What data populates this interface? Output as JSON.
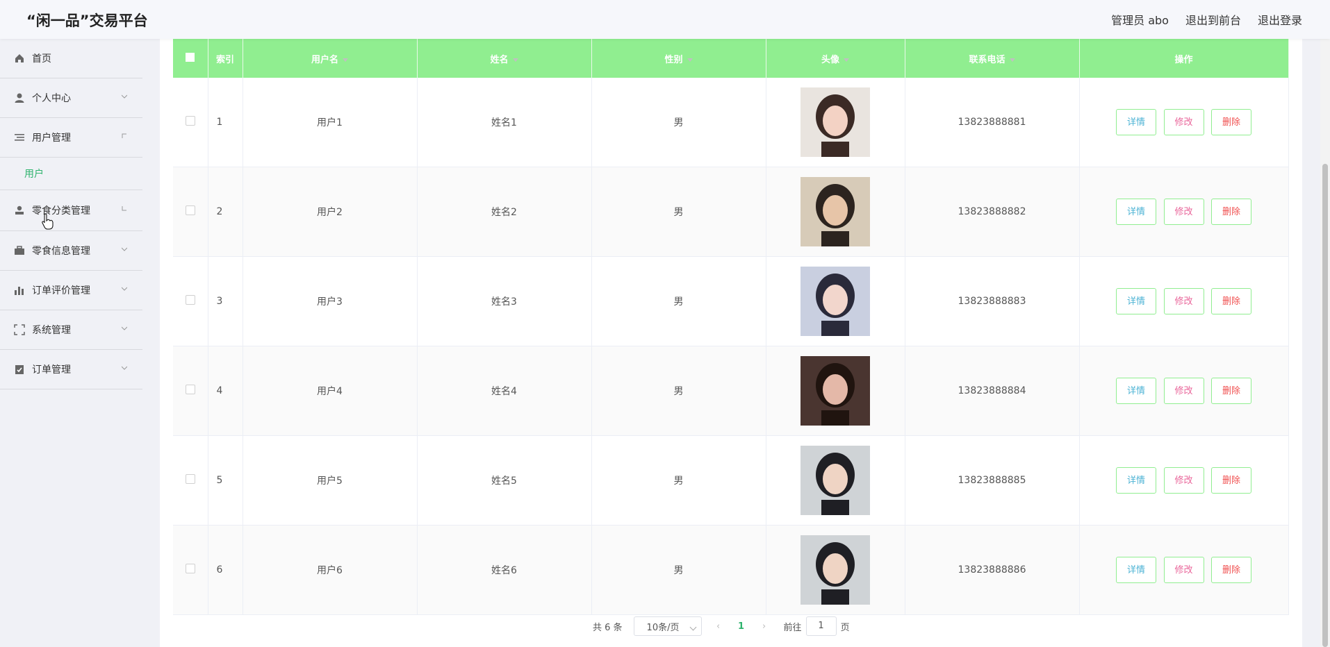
{
  "header": {
    "title": "“闲一品”交易平台",
    "admin": "管理员 abo",
    "to_front": "退出到前台",
    "logout": "退出登录"
  },
  "sidebar": {
    "items": [
      {
        "label": "首页",
        "icon": "home-icon"
      },
      {
        "label": "个人中心",
        "icon": "user-icon"
      },
      {
        "label": "用户管理",
        "icon": "list-icon"
      },
      {
        "label": "零食分类管理",
        "icon": "person-icon"
      },
      {
        "label": "零食信息管理",
        "icon": "briefcase-icon"
      },
      {
        "label": "订单评价管理",
        "icon": "bar-chart-icon"
      },
      {
        "label": "系统管理",
        "icon": "frame-icon"
      },
      {
        "label": "订单管理",
        "icon": "clipboard-icon"
      }
    ],
    "submenu": "用户"
  },
  "table": {
    "headers": {
      "index": "索引",
      "username": "用户名",
      "name": "姓名",
      "gender": "性别",
      "avatar": "头像",
      "phone": "联系电话",
      "actions": "操作"
    },
    "rows": [
      {
        "index": "1",
        "username": "用户1",
        "name": "姓名1",
        "gender": "男",
        "phone": "13823888881"
      },
      {
        "index": "2",
        "username": "用户2",
        "name": "姓名2",
        "gender": "男",
        "phone": "13823888882"
      },
      {
        "index": "3",
        "username": "用户3",
        "name": "姓名3",
        "gender": "男",
        "phone": "13823888883"
      },
      {
        "index": "4",
        "username": "用户4",
        "name": "姓名4",
        "gender": "男",
        "phone": "13823888884"
      },
      {
        "index": "5",
        "username": "用户5",
        "name": "姓名5",
        "gender": "男",
        "phone": "13823888885"
      },
      {
        "index": "6",
        "username": "用户6",
        "name": "姓名6",
        "gender": "男",
        "phone": "13823888886"
      }
    ],
    "buttons": {
      "detail": "详情",
      "edit": "修改",
      "delete": "删除"
    }
  },
  "pagination": {
    "total": "共 6 条",
    "page_size": "10条/页",
    "current_page": "1",
    "goto_label": "前往",
    "goto_value": "1",
    "page_suffix": "页"
  },
  "colors": {
    "header_green": "#90ee90",
    "accent": "#2fb36e"
  }
}
